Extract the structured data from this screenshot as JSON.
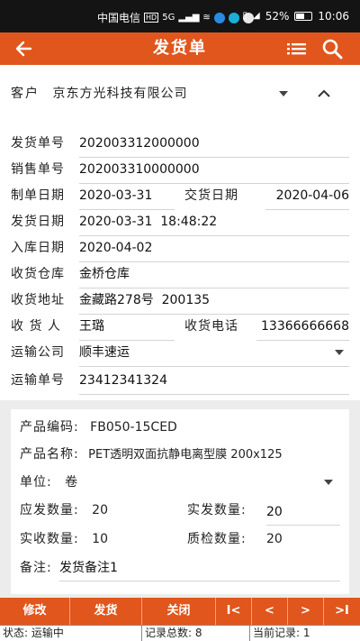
{
  "status_bar": {
    "carrier": "中国电信",
    "hd_badge": "HD",
    "network": "5G",
    "battery": "52%",
    "time": "10:06"
  },
  "app_bar": {
    "title": "发货单",
    "icons": [
      "back-arrow-icon",
      "list-icon",
      "search-icon"
    ]
  },
  "header": {
    "customer_label": "客户",
    "customer_value": "京东方光科技有限公司",
    "fields": {
      "ship_no_label": "发货单号",
      "ship_no": "202003312000000",
      "sales_no_label": "销售单号",
      "sales_no": "202003310000000",
      "create_date_label": "制单日期",
      "create_date": "2020-03-31",
      "delivery_date_label": "交货日期",
      "delivery_date": "2020-04-06",
      "ship_date_label": "发货日期",
      "ship_date": "2020-03-31  18:48:22",
      "stock_in_date_label": "入库日期",
      "stock_in_date": "2020-04-02",
      "warehouse_label": "收货仓库",
      "warehouse": "金桥仓库",
      "address_label": "收货地址",
      "address": "金藏路278号  200135",
      "receiver_label": "收 货 人",
      "receiver": "王璐",
      "phone_label": "收货电话",
      "phone": "13366666668",
      "carrier_label": "运输公司",
      "carrier": "顺丰速运",
      "tracking_label": "运输单号",
      "tracking": "23412341324"
    }
  },
  "detail": {
    "product_code_label": "产品编码:",
    "product_code": "FB050-15CED",
    "product_name_label": "产品名称:",
    "product_name": "PET透明双面抗静电离型膜 200x125",
    "unit_label": "单位:",
    "unit": "卷",
    "qty_due_label": "应发数量:",
    "qty_due": "20",
    "qty_sent_label": "实发数量:",
    "qty_sent": "20",
    "qty_received_label": "实收数量:",
    "qty_received": "10",
    "qty_inspected_label": "质检数量:",
    "qty_inspected": "20",
    "remark_label": "备注:",
    "remark": "发货备注1"
  },
  "toolbar": {
    "edit": "修改",
    "ship": "发货",
    "close": "关闭",
    "first": "I<",
    "prev": "<",
    "next": ">",
    "last": ">I"
  },
  "status_line": {
    "state": "状态: 运输中",
    "total": "记录总数: 8",
    "current": "当前记录: 1"
  },
  "colors": {
    "accent": "#e0561c",
    "status_bar": "#141414",
    "background": "#ececec"
  }
}
